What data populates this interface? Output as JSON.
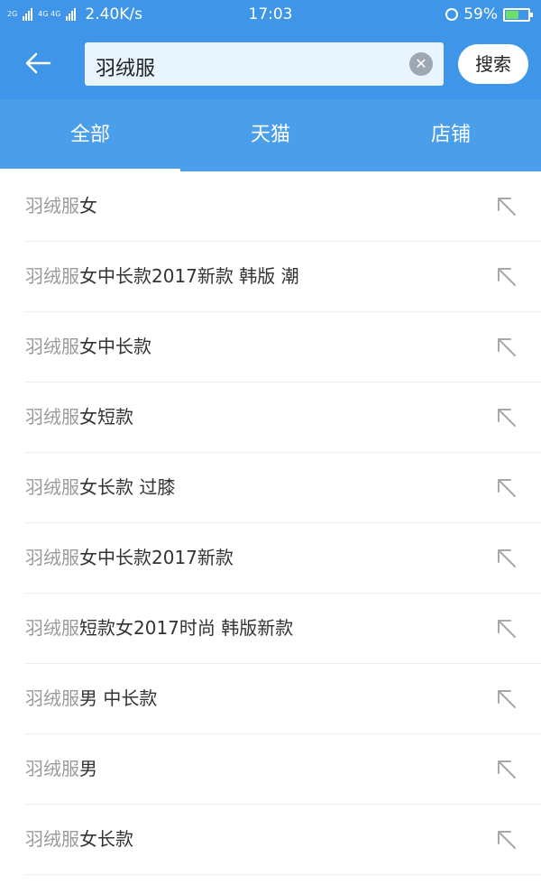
{
  "status_bar": {
    "sim1_label": "2G",
    "sim2_label": "4G 4G",
    "network_speed": "2.40K/s",
    "time": "17:03",
    "battery_percent": "59%",
    "battery_level": 0.59,
    "battery_color": "#6ce06a"
  },
  "search": {
    "query": "羽绒服",
    "clear_icon": "clear-circle-icon",
    "submit_label": "搜索",
    "back_icon": "arrow-left-icon"
  },
  "tabs": [
    {
      "label": "全部",
      "active": true
    },
    {
      "label": "天猫",
      "active": false
    },
    {
      "label": "店铺",
      "active": false
    }
  ],
  "suggestions": [
    {
      "match": "羽绒服",
      "rest": "女"
    },
    {
      "match": "羽绒服",
      "rest": "女中长款2017新款 韩版 潮"
    },
    {
      "match": "羽绒服",
      "rest": "女中长款"
    },
    {
      "match": "羽绒服",
      "rest": "女短款"
    },
    {
      "match": "羽绒服",
      "rest": "女长款 过膝"
    },
    {
      "match": "羽绒服",
      "rest": "女中长款2017新款"
    },
    {
      "match": "羽绒服",
      "rest": "短款女2017时尚 韩版新款"
    },
    {
      "match": "羽绒服",
      "rest": "男 中长款"
    },
    {
      "match": "羽绒服",
      "rest": "男"
    },
    {
      "match": "羽绒服",
      "rest": "女长款"
    }
  ],
  "colors": {
    "header_blue": "#3f95e8",
    "tab_blue": "#4a9eea",
    "match_gray": "#9a9a9a",
    "text_dark": "#333333"
  }
}
